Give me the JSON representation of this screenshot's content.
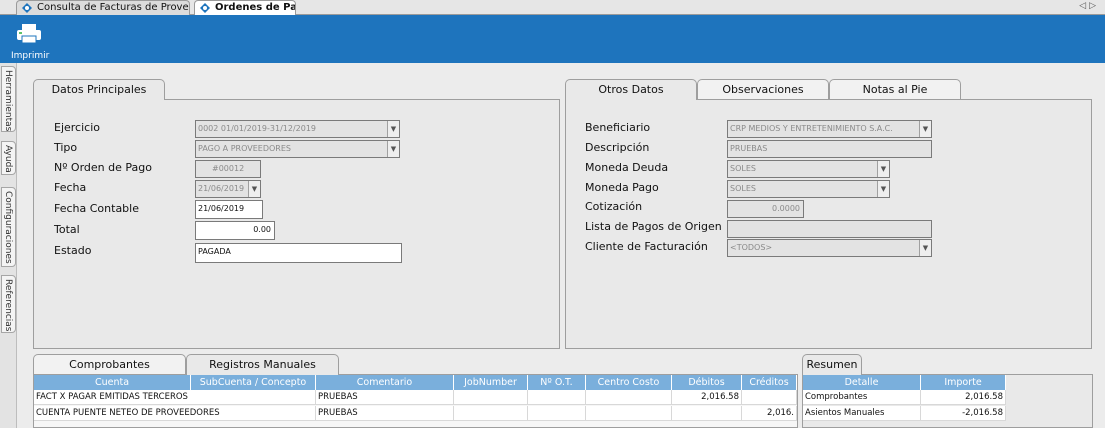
{
  "tabs": [
    {
      "label": "Consulta de Facturas de Proveedor.",
      "active": false
    },
    {
      "label": "Ordenes de Pago",
      "active": true
    }
  ],
  "toolbar": {
    "print_label": "Imprimir"
  },
  "sidebar": {
    "items": [
      "Herramientas",
      "Ayuda",
      "Configuraciones",
      "Referencias"
    ]
  },
  "datos_principales": {
    "tab_label": "Datos Principales",
    "ejercicio": {
      "label": "Ejercicio",
      "value": "0002 01/01/2019-31/12/2019"
    },
    "tipo": {
      "label": "Tipo",
      "value": "PAGO A PROVEEDORES"
    },
    "orden": {
      "label": "Nº Orden de Pago",
      "value": "#00012"
    },
    "fecha": {
      "label": "Fecha",
      "value": "21/06/2019"
    },
    "fecha_contable": {
      "label": "Fecha Contable",
      "value": "21/06/2019"
    },
    "total": {
      "label": "Total",
      "value": "0.00"
    },
    "estado": {
      "label": "Estado",
      "value": "PAGADA"
    }
  },
  "otros_datos": {
    "tabs": [
      "Otros Datos",
      "Observaciones",
      "Notas al Pie"
    ],
    "beneficiario": {
      "label": "Beneficiario",
      "value": "CRP MEDIOS Y ENTRETENIMIENTO S.A.C."
    },
    "descripcion": {
      "label": "Descripción",
      "value": "PRUEBAS"
    },
    "moneda_deuda": {
      "label": "Moneda Deuda",
      "value": "SOLES"
    },
    "moneda_pago": {
      "label": "Moneda Pago",
      "value": "SOLES"
    },
    "cotizacion": {
      "label": "Cotización",
      "value": "0.0000"
    },
    "lista_pagos": {
      "label": "Lista de Pagos de Origen",
      "value": ""
    },
    "cliente": {
      "label": "Cliente de Facturación",
      "value": "<TODOS>"
    }
  },
  "registros": {
    "tabs": [
      "Comprobantes",
      "Registros Manuales"
    ],
    "columns": [
      "Cuenta",
      "SubCuenta / Concepto",
      "Comentario",
      "JobNumber",
      "Nº O.T.",
      "Centro Costo",
      "Débitos",
      "Créditos"
    ],
    "rows": [
      {
        "cuenta": "FACT X PAGAR EMITIDAS TERCEROS",
        "subcuenta": "",
        "comentario": "PRUEBAS",
        "job": "",
        "ot": "",
        "centro": "",
        "debitos": "2,016.58",
        "creditos": ""
      },
      {
        "cuenta": "CUENTA PUENTE NETEO DE PROVEEDORES",
        "subcuenta": "",
        "comentario": "PRUEBAS",
        "job": "",
        "ot": "",
        "centro": "",
        "debitos": "",
        "creditos": "2,016."
      }
    ]
  },
  "resumen": {
    "tab_label": "Resumen",
    "columns": [
      "Detalle",
      "Importe"
    ],
    "rows": [
      {
        "detalle": "Comprobantes",
        "importe": "2,016.58"
      },
      {
        "detalle": "Asientos Manuales",
        "importe": "-2,016.58"
      }
    ]
  },
  "colors": {
    "toolbar": "#1e74bd",
    "grid_header": "#7aafdc"
  }
}
